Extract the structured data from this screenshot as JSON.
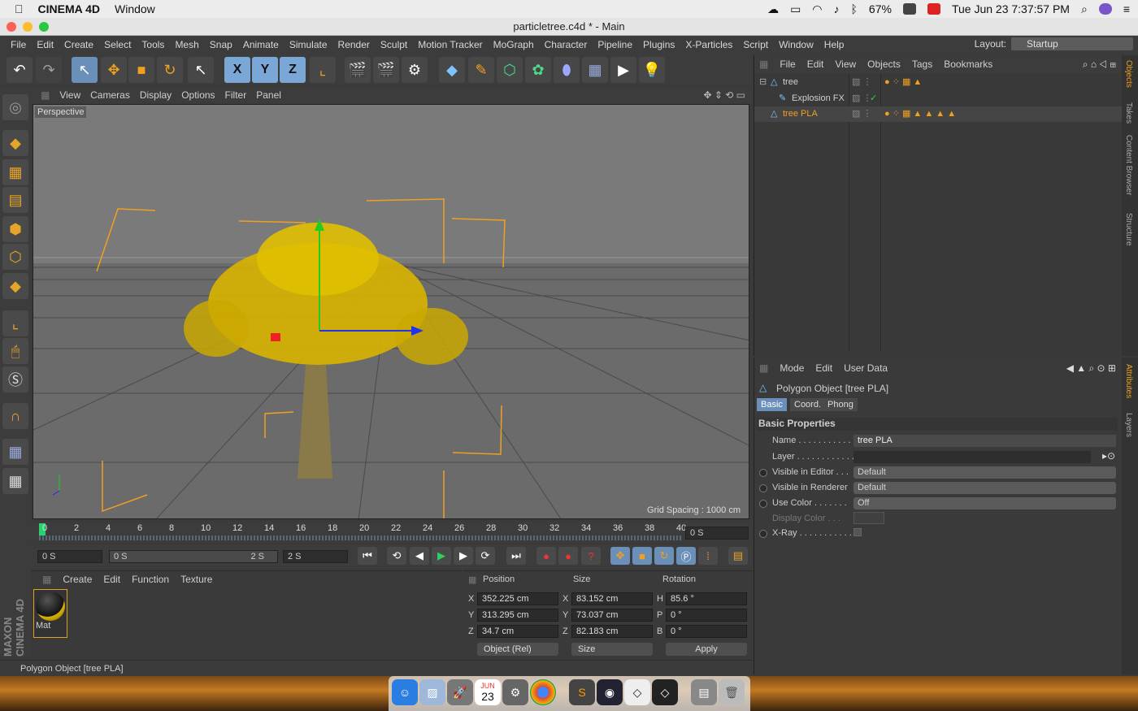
{
  "macbar": {
    "app": "CINEMA 4D",
    "menu": "Window",
    "battery": "67%",
    "clock": "Tue Jun 23  7:37:57 PM"
  },
  "window": {
    "title": "particletree.c4d * - Main"
  },
  "menu": [
    "File",
    "Edit",
    "Create",
    "Select",
    "Tools",
    "Mesh",
    "Snap",
    "Animate",
    "Simulate",
    "Render",
    "Sculpt",
    "Motion Tracker",
    "MoGraph",
    "Character",
    "Pipeline",
    "Plugins",
    "X-Particles",
    "Script",
    "Window",
    "Help"
  ],
  "layout": {
    "label": "Layout:",
    "value": "Startup"
  },
  "toolbar": {
    "x": "X",
    "y": "Y",
    "z": "Z"
  },
  "viewport": {
    "menu": [
      "View",
      "Cameras",
      "Display",
      "Options",
      "Filter",
      "Panel"
    ],
    "label": "Perspective",
    "grid": "Grid Spacing : 1000 cm"
  },
  "timeline": {
    "ticks": [
      "0",
      "2",
      "4",
      "6",
      "8",
      "10",
      "12",
      "14",
      "16",
      "18",
      "20",
      "22",
      "24",
      "26",
      "28",
      "30",
      "32",
      "34",
      "36",
      "38",
      "40"
    ],
    "current": "0 S",
    "start": "0 S",
    "range_start": "0 S",
    "range_end": "2 S",
    "end": "2 S"
  },
  "materials": {
    "menu": [
      "Create",
      "Edit",
      "Function",
      "Texture"
    ],
    "items": [
      {
        "name": "Mat"
      }
    ]
  },
  "coords": {
    "headers": [
      "Position",
      "Size",
      "Rotation"
    ],
    "rows": [
      {
        "axis": "X",
        "pos": "352.225 cm",
        "saxis": "X",
        "size": "83.152 cm",
        "raxis": "H",
        "rot": "85.6 °"
      },
      {
        "axis": "Y",
        "pos": "313.295 cm",
        "saxis": "Y",
        "size": "73.037 cm",
        "raxis": "P",
        "rot": "0 °"
      },
      {
        "axis": "Z",
        "pos": "34.7 cm",
        "saxis": "Z",
        "size": "82.183 cm",
        "raxis": "B",
        "rot": "0 °"
      }
    ],
    "mode": "Object (Rel)",
    "size_mode": "Size",
    "apply": "Apply"
  },
  "status": "Polygon Object [tree PLA]",
  "objects": {
    "menu": [
      "File",
      "Edit",
      "View",
      "Objects",
      "Tags",
      "Bookmarks"
    ],
    "items": [
      {
        "name": "tree"
      },
      {
        "name": "Explosion FX"
      },
      {
        "name": "tree PLA"
      }
    ]
  },
  "attributes": {
    "menu": [
      "Mode",
      "Edit",
      "User Data"
    ],
    "object": "Polygon Object [tree PLA]",
    "tabs": [
      "Basic",
      "Coord.",
      "Phong"
    ],
    "section": "Basic Properties",
    "props": [
      {
        "label": "Name . . . . . . . . . . . .",
        "value": "tree PLA"
      },
      {
        "label": "Layer . . . . . . . . . . . .",
        "value": ""
      },
      {
        "label": "Visible in Editor . . .",
        "value": "Default"
      },
      {
        "label": "Visible in Renderer",
        "value": "Default"
      },
      {
        "label": "Use Color . . . . . . .",
        "value": "Off"
      },
      {
        "label": "Display Color . . .",
        "value": ""
      },
      {
        "label": "X-Ray . . . . . . . . . . .",
        "value": ""
      }
    ]
  },
  "sidetabs": {
    "top": [
      "Objects",
      "Takes",
      "Content Browser",
      "Structure"
    ],
    "bottom": [
      "Attributes",
      "Layers"
    ]
  },
  "brand": {
    "logo": "MAXON CINEMA 4D"
  },
  "dock": {
    "date": "23",
    "month": "JUN"
  },
  "colors": {
    "accent": "#6a8fb8",
    "orange": "#f0a020",
    "tree": "#d9b400"
  }
}
